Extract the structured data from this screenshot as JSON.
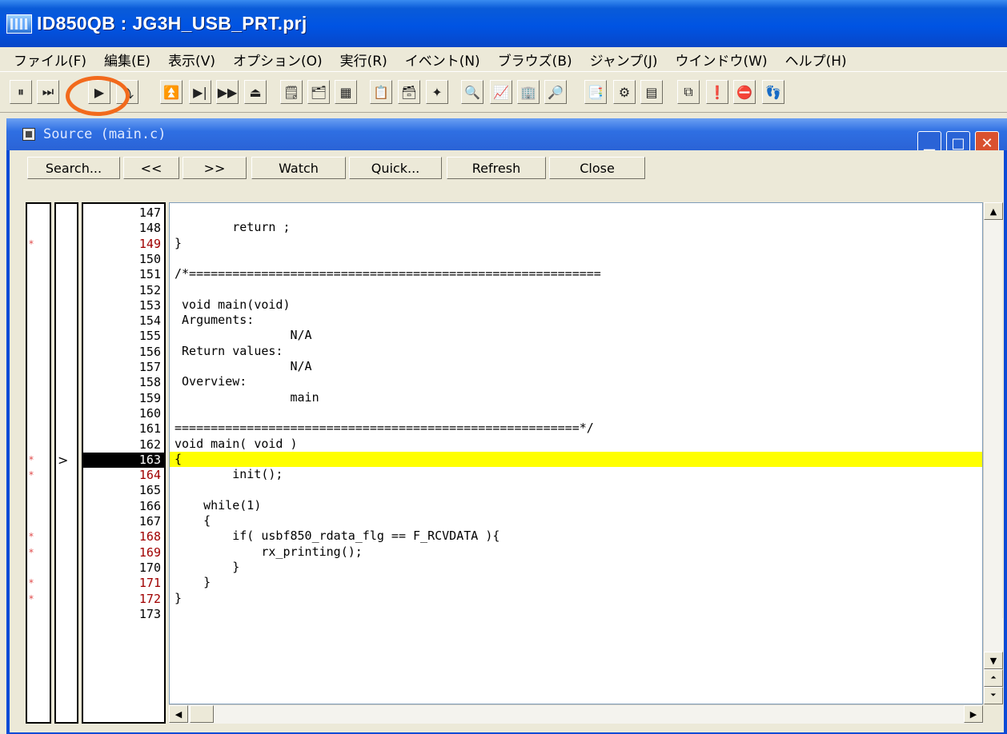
{
  "window": {
    "title": "ID850QB : JG3H_USB_PRT.prj"
  },
  "menu": [
    "ファイル(F)",
    "編集(E)",
    "表示(V)",
    "オプション(O)",
    "実行(R)",
    "イベント(N)",
    "ブラウズ(B)",
    "ジャンプ(J)",
    "ウインドウ(W)",
    "ヘルプ(H)"
  ],
  "toolbar": {
    "buttons": [
      "stop",
      "restart",
      "run",
      "step-in",
      "return-out",
      "step-over",
      "run-to",
      "eject",
      "source",
      "assemble",
      "memory",
      "register",
      "io",
      "watch",
      "quick",
      "trace",
      "coverage",
      "event",
      "tracer",
      "snap",
      "stub",
      "stop-event",
      "timer",
      "log",
      "misc"
    ]
  },
  "source": {
    "title": "Source (main.c)",
    "buttons": {
      "search": "Search...",
      "prev": "<<",
      "next": ">>",
      "watch": "Watch",
      "quick": "Quick...",
      "refresh": "Refresh",
      "close": "Close"
    },
    "lines": [
      {
        "num": "147",
        "text": "",
        "mark": "",
        "bp": false,
        "current": false
      },
      {
        "num": "148",
        "text": "        return ;",
        "mark": "",
        "bp": false,
        "current": false
      },
      {
        "num": "149",
        "text": "}",
        "mark": "*",
        "bp": true,
        "current": false
      },
      {
        "num": "150",
        "text": "",
        "mark": "",
        "bp": false,
        "current": false
      },
      {
        "num": "151",
        "text": "/*=========================================================",
        "mark": "",
        "bp": false,
        "current": false
      },
      {
        "num": "152",
        "text": "",
        "mark": "",
        "bp": false,
        "current": false
      },
      {
        "num": "153",
        "text": " void main(void)",
        "mark": "",
        "bp": false,
        "current": false
      },
      {
        "num": "154",
        "text": " Arguments:",
        "mark": "",
        "bp": false,
        "current": false
      },
      {
        "num": "155",
        "text": "                N/A",
        "mark": "",
        "bp": false,
        "current": false
      },
      {
        "num": "156",
        "text": " Return values:",
        "mark": "",
        "bp": false,
        "current": false
      },
      {
        "num": "157",
        "text": "                N/A",
        "mark": "",
        "bp": false,
        "current": false
      },
      {
        "num": "158",
        "text": " Overview:",
        "mark": "",
        "bp": false,
        "current": false
      },
      {
        "num": "159",
        "text": "                main",
        "mark": "",
        "bp": false,
        "current": false
      },
      {
        "num": "160",
        "text": "",
        "mark": "",
        "bp": false,
        "current": false
      },
      {
        "num": "161",
        "text": "========================================================*/",
        "mark": "",
        "bp": false,
        "current": false
      },
      {
        "num": "162",
        "text": "void main( void )",
        "mark": "",
        "bp": false,
        "current": false
      },
      {
        "num": "163",
        "text": "{",
        "mark": "*",
        "bp": true,
        "current": true
      },
      {
        "num": "164",
        "text": "        init();",
        "mark": "*",
        "bp": true,
        "current": false
      },
      {
        "num": "165",
        "text": "",
        "mark": "",
        "bp": false,
        "current": false
      },
      {
        "num": "166",
        "text": "    while(1)",
        "mark": "",
        "bp": false,
        "current": false
      },
      {
        "num": "167",
        "text": "    {",
        "mark": "",
        "bp": false,
        "current": false
      },
      {
        "num": "168",
        "text": "        if( usbf850_rdata_flg == F_RCVDATA ){",
        "mark": "*",
        "bp": true,
        "current": false
      },
      {
        "num": "169",
        "text": "            rx_printing();",
        "mark": "*",
        "bp": true,
        "current": false
      },
      {
        "num": "170",
        "text": "        }",
        "mark": "",
        "bp": false,
        "current": false
      },
      {
        "num": "171",
        "text": "    }",
        "mark": "*",
        "bp": true,
        "current": false
      },
      {
        "num": "172",
        "text": "}",
        "mark": "*",
        "bp": true,
        "current": false
      },
      {
        "num": "173",
        "text": "",
        "mark": "",
        "bp": false,
        "current": false
      }
    ],
    "pc_marker": ">"
  },
  "colors": {
    "highlight": "#f26a1c",
    "current_line": "#ffff00",
    "breakpoint": "#a00000"
  }
}
